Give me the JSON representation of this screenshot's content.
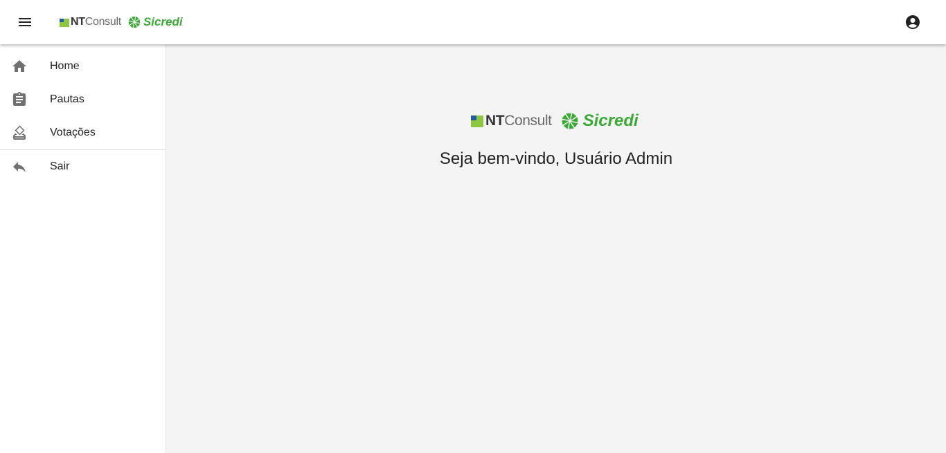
{
  "header": {
    "menu_icon": "menu-icon",
    "account_icon": "account-circle-icon",
    "brand": {
      "nt_bold": "NT",
      "nt_light": "Consult",
      "sicredi": "Sicredi"
    }
  },
  "sidebar": {
    "items": [
      {
        "label": "Home",
        "icon": "home-icon"
      },
      {
        "label": "Pautas",
        "icon": "clipboard-icon"
      },
      {
        "label": "Votações",
        "icon": "ballot-icon"
      }
    ],
    "footer_items": [
      {
        "label": "Sair",
        "icon": "reply-icon"
      }
    ]
  },
  "main": {
    "brand": {
      "nt_bold": "NT",
      "nt_light": "Consult",
      "sicredi": "Sicredi"
    },
    "welcome": "Seja bem-vindo, Usuário Admin"
  },
  "colors": {
    "appbar": "#ffffff",
    "background": "#f4f4f4",
    "icon": "#707070",
    "sicredi_green": "#3aaa35",
    "nt_green": "#8dc63f",
    "nt_blue": "#1f5fa8"
  }
}
